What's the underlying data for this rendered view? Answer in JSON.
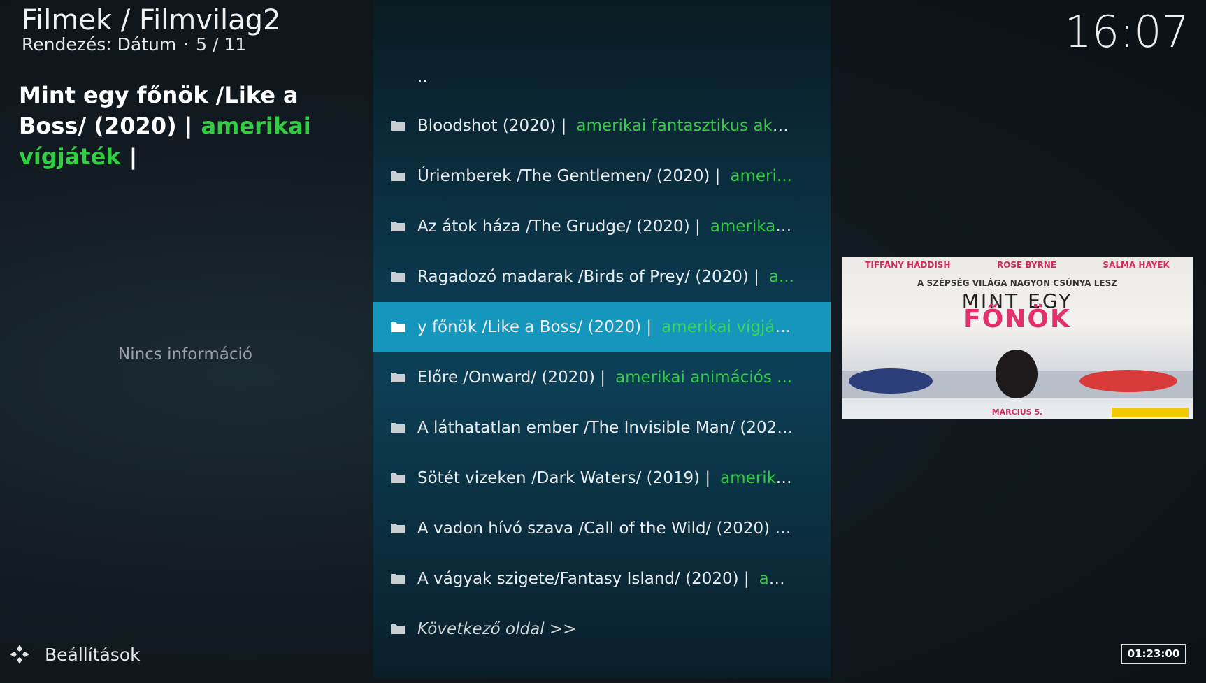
{
  "header": {
    "title": "Filmek / Filmvilag2",
    "sort_label": "Rendezés: Dátum",
    "position": "5 / 11"
  },
  "clock": "16:07",
  "info": {
    "title": "Mint egy főnök /Like a Boss/ (2020) |",
    "genre": "amerikai vígjáték",
    "trailing": "|",
    "no_info": "Nincs információ"
  },
  "list": {
    "parent": "..",
    "items": [
      {
        "title": "Bloodshot (2020) |",
        "genre": "amerikai fantasztikus akc..."
      },
      {
        "title": "Úriemberek /The Gentlemen/ (2020) |",
        "genre": "ameri..."
      },
      {
        "title": "Az átok háza /The Grudge/ (2020) |",
        "genre": "amerikai..."
      },
      {
        "title": "Ragadozó madarak /Birds of Prey/ (2020) |",
        "genre": "a..."
      },
      {
        "title": "y főnök /Like a Boss/ (2020) |",
        "genre": "amerikai vígjáték"
      },
      {
        "title": "Előre /Onward/ (2020) |",
        "genre": "amerikai animációs ..."
      },
      {
        "title": "A láthatatlan ember /The Invisible Man/ (202...",
        "genre": ""
      },
      {
        "title": "Sötét vizeken /Dark Waters/ (2019) |",
        "genre": "amerika..."
      },
      {
        "title": "A vadon hívó szava /Call of the Wild/ (2020) |",
        "genre": "..."
      },
      {
        "title": "A vágyak szigete/Fantasy Island/ (2020) |",
        "genre": "am..."
      }
    ],
    "next_page": "Következő oldal >>",
    "selected_index": 4
  },
  "poster": {
    "actors": [
      "TIFFANY HADDISH",
      "ROSE BYRNE",
      "SALMA HAYEK"
    ],
    "tagline": "A SZÉPSÉG VILÁGA NAGYON CSÚNYA LESZ",
    "title_line1": "MINT EGY",
    "title_line2": "FŐNÖK",
    "release": "MÁRCIUS 5."
  },
  "footer": {
    "settings_label": "Beállítások",
    "duration": "01:23:00"
  },
  "colors": {
    "accent_genre": "#33cc44",
    "selected_bg": "#1596bd",
    "list_panel": "#0c3f56"
  }
}
